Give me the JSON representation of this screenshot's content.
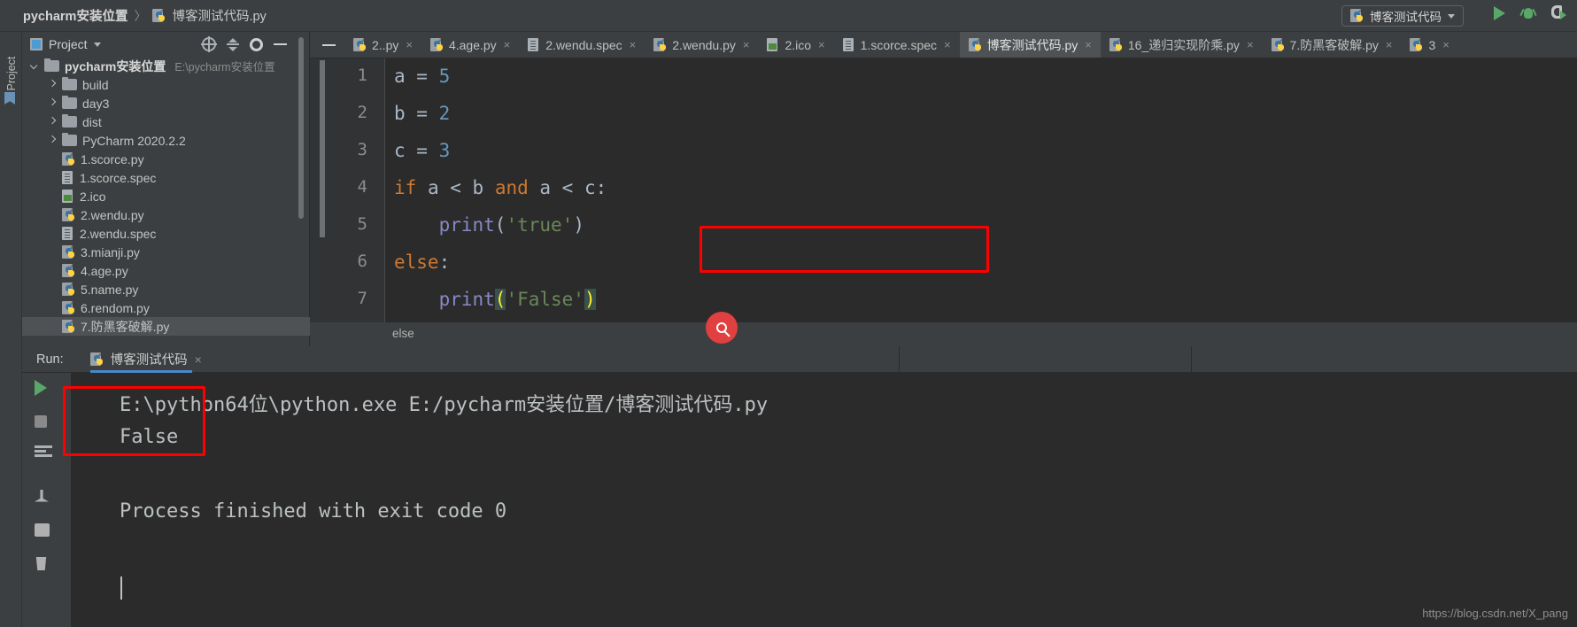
{
  "titlebar": {
    "project_name": "pycharm安装位置",
    "separator": "〉",
    "file_name": "博客测试代码.py",
    "run_config": "博客测试代码",
    "run_button": "run-button",
    "debug_button": "debug-button",
    "coverage_button": "run-coverage-button"
  },
  "left_strip": {
    "project_tab": "1: Project"
  },
  "project_panel": {
    "title": "Project",
    "root": {
      "label": "pycharm安装位置",
      "path": "E:\\pycharm安装位置"
    },
    "items": [
      {
        "label": "build",
        "type": "folder",
        "expandable": true
      },
      {
        "label": "day3",
        "type": "folder",
        "expandable": true
      },
      {
        "label": "dist",
        "type": "folder",
        "expandable": true
      },
      {
        "label": "PyCharm 2020.2.2",
        "type": "folder",
        "expandable": true
      },
      {
        "label": "1.scorce.py",
        "type": "python"
      },
      {
        "label": "1.scorce.spec",
        "type": "spec"
      },
      {
        "label": "2.ico",
        "type": "image"
      },
      {
        "label": "2.wendu.py",
        "type": "python"
      },
      {
        "label": "2.wendu.spec",
        "type": "spec"
      },
      {
        "label": "3.mianji.py",
        "type": "python"
      },
      {
        "label": "4.age.py",
        "type": "python"
      },
      {
        "label": "5.name.py",
        "type": "python"
      },
      {
        "label": "6.rendom.py",
        "type": "python"
      },
      {
        "label": "7.防黑客破解.py",
        "type": "python",
        "selected": true
      }
    ]
  },
  "editor_tabs": [
    {
      "label": "2..py",
      "type": "python",
      "active": false
    },
    {
      "label": "4.age.py",
      "type": "python",
      "active": false
    },
    {
      "label": "2.wendu.spec",
      "type": "spec",
      "active": false
    },
    {
      "label": "2.wendu.py",
      "type": "python",
      "active": false
    },
    {
      "label": "2.ico",
      "type": "image",
      "active": false
    },
    {
      "label": "1.scorce.spec",
      "type": "spec",
      "active": false
    },
    {
      "label": "博客测试代码.py",
      "type": "python",
      "active": true
    },
    {
      "label": "16_递归实现阶乘.py",
      "type": "python",
      "active": false
    },
    {
      "label": "7.防黑客破解.py",
      "type": "python",
      "active": false
    },
    {
      "label": "3",
      "type": "python",
      "active": false
    }
  ],
  "editor": {
    "close_symbol": "×",
    "lines": [
      {
        "num": "1",
        "tokens": [
          {
            "t": "a",
            "c": "k-var"
          },
          {
            "t": " = ",
            "c": "k-op"
          },
          {
            "t": "5",
            "c": "k-num"
          }
        ]
      },
      {
        "num": "2",
        "tokens": [
          {
            "t": "b",
            "c": "k-var"
          },
          {
            "t": " = ",
            "c": "k-op"
          },
          {
            "t": "2",
            "c": "k-num"
          }
        ]
      },
      {
        "num": "3",
        "tokens": [
          {
            "t": "c",
            "c": "k-var"
          },
          {
            "t": " = ",
            "c": "k-op"
          },
          {
            "t": "3",
            "c": "k-num"
          }
        ]
      },
      {
        "num": "4",
        "tokens": [
          {
            "t": "if",
            "c": "k-kw"
          },
          {
            "t": " a < b ",
            "c": "k-var"
          },
          {
            "t": "and",
            "c": "k-kw"
          },
          {
            "t": " a < c:",
            "c": "k-var"
          }
        ]
      },
      {
        "num": "5",
        "tokens": [
          {
            "t": "    ",
            "c": "k-op"
          },
          {
            "t": "print",
            "c": "k-fn"
          },
          {
            "t": "(",
            "c": "k-op"
          },
          {
            "t": "'true'",
            "c": "k-str"
          },
          {
            "t": ")",
            "c": "k-op"
          }
        ]
      },
      {
        "num": "6",
        "tokens": [
          {
            "t": "else",
            "c": "k-kw"
          },
          {
            "t": ":",
            "c": "k-op"
          }
        ]
      },
      {
        "num": "7",
        "tokens": [
          {
            "t": "    ",
            "c": "k-op"
          },
          {
            "t": "print",
            "c": "k-fn"
          },
          {
            "t": "(",
            "c": "k-paren-hl"
          },
          {
            "t": "'False'",
            "c": "k-str"
          },
          {
            "t": ")",
            "c": "k-paren-hl"
          }
        ]
      }
    ],
    "breadcrumb": "else",
    "search_icon": "search-icon"
  },
  "run_panel": {
    "run_label": "Run:",
    "tab_label": "博客测试代码",
    "close_symbol": "×",
    "console_lines": [
      "E:\\python64位\\python.exe E:/pycharm安装位置/博客测试代码.py",
      "False",
      "",
      "Process finished with exit code 0"
    ],
    "sidebar_icons": [
      "rerun-icon",
      "stop-icon",
      "soft-wrap-icon",
      "pin-icon",
      "print-icon",
      "trash-icon"
    ]
  },
  "watermark": "https://blog.csdn.net/X_pang",
  "colors": {
    "accent_blue": "#4a88c7",
    "highlight_red": "#ff0000",
    "run_green": "#59a869",
    "editor_bg": "#2b2b2b",
    "panel_bg": "#3c3f41"
  }
}
